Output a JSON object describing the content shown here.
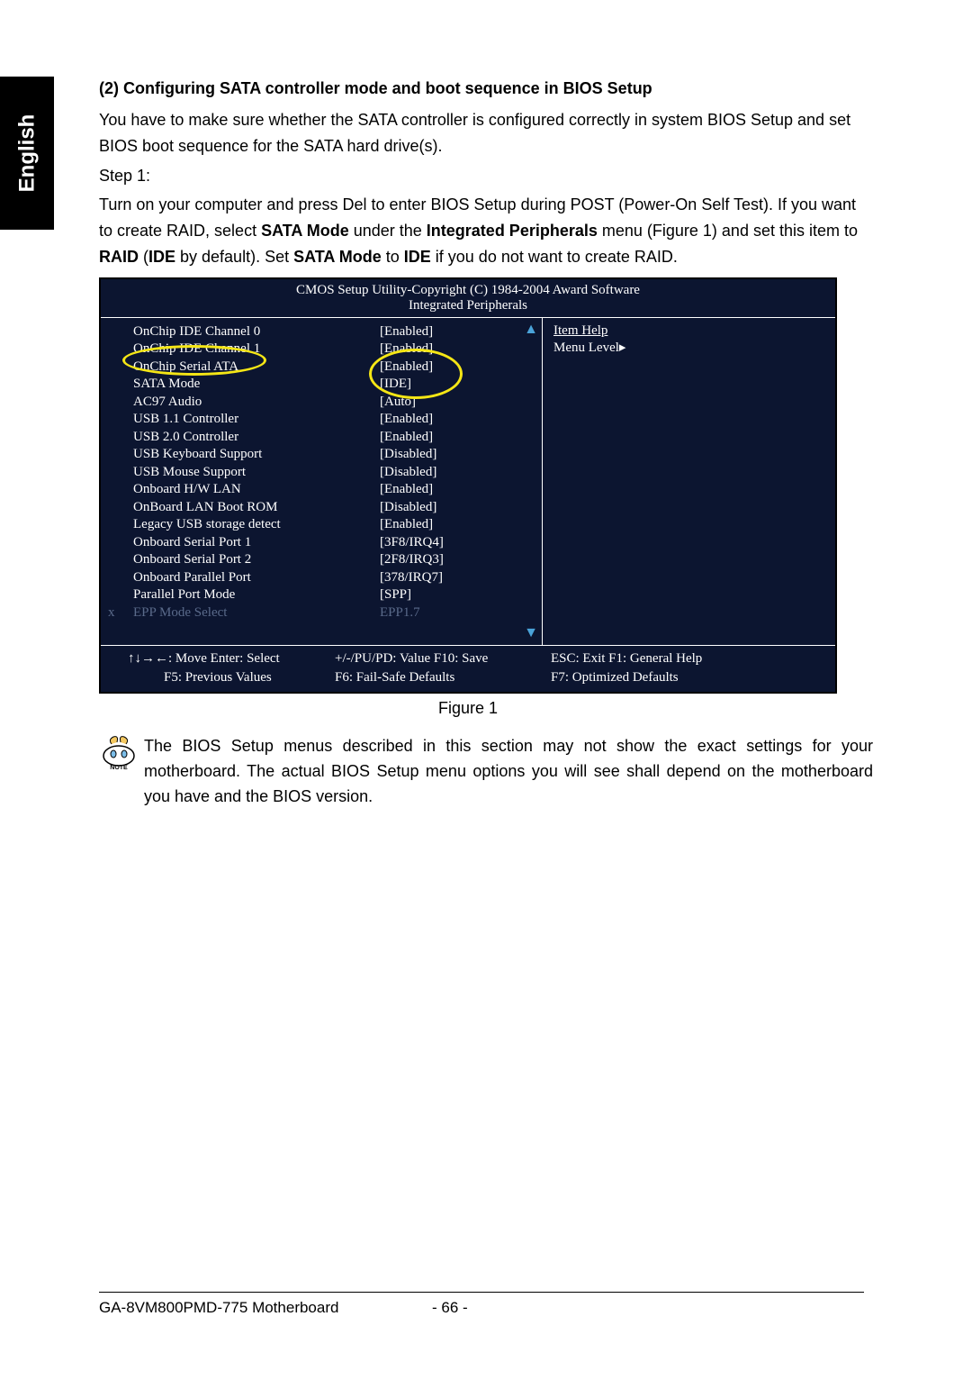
{
  "lang_tab": "English",
  "heading": "(2)  Configuring SATA controller mode and boot sequence in BIOS Setup",
  "para1": "You have to make sure whether the SATA controller is configured correctly in system BIOS Setup and set BIOS boot sequence for the SATA hard drive(s).",
  "step_label": "Step 1:",
  "para2_a": "Turn on your computer and press Del to enter BIOS Setup during POST (Power-On Self Test). If you want to create RAID, select ",
  "bold_sata_mode": "SATA Mode",
  "para2_b": " under the ",
  "bold_integrated": "Integrated Peripherals",
  "para2_c": " menu (Figure 1) and set this item to ",
  "bold_raid": "RAID",
  "para2_d": " (",
  "bold_ide1": "IDE",
  "para2_e": " by default). Set ",
  "bold_sata_mode2": "SATA Mode",
  "para2_f": " to ",
  "bold_ide2": "IDE",
  "para2_g": " if you do not want to create RAID.",
  "bios": {
    "title": "CMOS Setup Utility-Copyright (C) 1984-2004 Award Software",
    "subtitle": "Integrated Peripherals",
    "rows": [
      {
        "label": "OnChip IDE Channel 0",
        "val": "[Enabled]",
        "dim": false
      },
      {
        "label": "OnChip IDE Channel 1",
        "val": "[Enabled]",
        "dim": false
      },
      {
        "label": "OnChip Serial ATA",
        "val": "[Enabled]",
        "dim": false
      },
      {
        "label": "SATA Mode",
        "val": "[IDE]",
        "dim": false
      },
      {
        "label": "AC97 Audio",
        "val": "[Auto]",
        "dim": false
      },
      {
        "label": "USB 1.1 Controller",
        "val": "[Enabled]",
        "dim": false
      },
      {
        "label": "USB 2.0 Controller",
        "val": "[Enabled]",
        "dim": false
      },
      {
        "label": "USB Keyboard Support",
        "val": "[Disabled]",
        "dim": false
      },
      {
        "label": "USB Mouse Support",
        "val": "[Disabled]",
        "dim": false
      },
      {
        "label": "Onboard H/W LAN",
        "val": "[Enabled]",
        "dim": false
      },
      {
        "label": "OnBoard LAN Boot ROM",
        "val": "[Disabled]",
        "dim": false
      },
      {
        "label": "Legacy USB storage detect",
        "val": "[Enabled]",
        "dim": false
      },
      {
        "label": "Onboard Serial Port 1",
        "val": "[3F8/IRQ4]",
        "dim": false
      },
      {
        "label": "Onboard Serial Port 2",
        "val": "[2F8/IRQ3]",
        "dim": false
      },
      {
        "label": "Onboard Parallel Port",
        "val": "[378/IRQ7]",
        "dim": false
      },
      {
        "label": "Parallel Port Mode",
        "val": "[SPP]",
        "dim": false
      },
      {
        "label": "EPP Mode Select",
        "val": "EPP1.7",
        "dim": true,
        "x": "x"
      }
    ],
    "help_title": "Item Help",
    "menu_level": "Menu Level▸",
    "footer": {
      "c1a": "↑↓→←: Move      Enter: Select",
      "c1b": "F5: Previous Values",
      "c2a": "+/-/PU/PD: Value       F10: Save",
      "c2b": "F6: Fail-Safe Defaults",
      "c3a": "ESC: Exit        F1: General Help",
      "c3b": "F7: Optimized Defaults"
    }
  },
  "figure_caption": "Figure 1",
  "note_label": "NOTE",
  "note_text": "The BIOS Setup menus described in this section may not show the exact settings for your motherboard. The actual BIOS Setup menu options you will see shall depend on the motherboard you have and the BIOS version.",
  "footer_product": "GA-8VM800PMD-775 Motherboard",
  "footer_page": "- 66 -"
}
